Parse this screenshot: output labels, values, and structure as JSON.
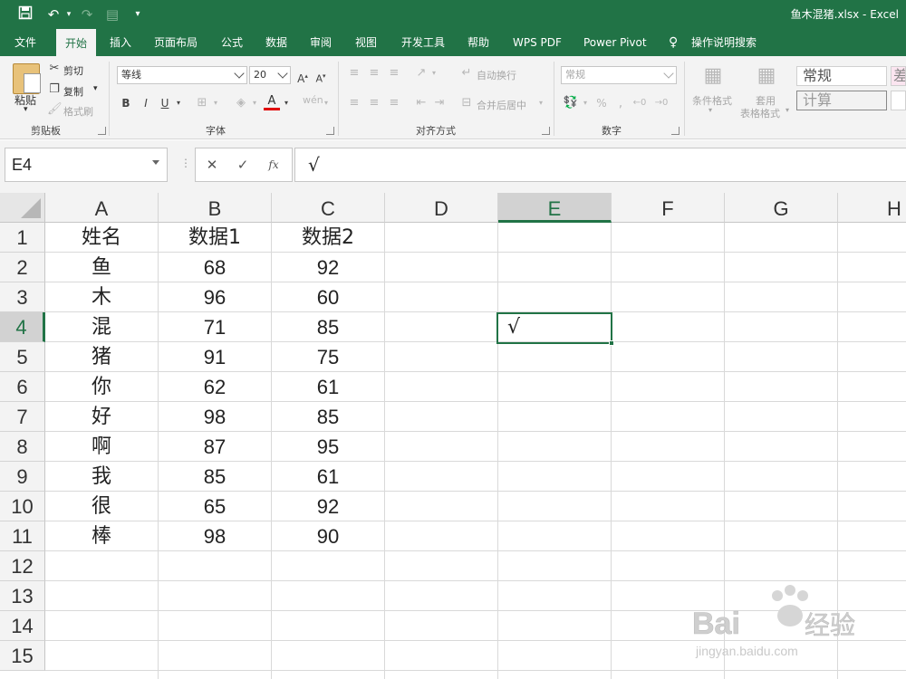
{
  "titlebar": {
    "title": "鱼木混猪.xlsx  -  Excel"
  },
  "tabs": [
    "文件",
    "开始",
    "插入",
    "页面布局",
    "公式",
    "数据",
    "审阅",
    "视图",
    "开发工具",
    "帮助",
    "WPS PDF",
    "Power Pivot"
  ],
  "active_tab": "开始",
  "help_search": "操作说明搜索",
  "ribbon": {
    "clipboard": {
      "paste": "粘贴",
      "cut": "剪切",
      "copy": "复制",
      "format_painter": "格式刷",
      "group": "剪贴板"
    },
    "font": {
      "name": "等线",
      "size": "20",
      "bold": "B",
      "italic": "I",
      "underline": "U",
      "group": "字体"
    },
    "alignment": {
      "wrap": "自动换行",
      "merge": "合并后居中",
      "group": "对齐方式"
    },
    "number": {
      "format": "常规",
      "percent": "%",
      "group": "数字"
    },
    "styles": {
      "conditional": "条件格式",
      "table_format_1": "套用",
      "table_format_2": "表格格式",
      "normal": "常规",
      "calc": "计算",
      "bad": "差"
    }
  },
  "formula_bar": {
    "name_box": "E4",
    "cancel": "✕",
    "enter": "✓",
    "fx": "fx",
    "content": "√"
  },
  "sheet": {
    "columns": [
      "A",
      "B",
      "C",
      "D",
      "E",
      "F",
      "G",
      "H"
    ],
    "rows": [
      "1",
      "2",
      "3",
      "4",
      "5",
      "6",
      "7",
      "8",
      "9",
      "10",
      "11",
      "12",
      "13",
      "14",
      "15"
    ],
    "selected_column": "E",
    "selected_row": "4",
    "header": [
      "姓名",
      "数据1",
      "数据2"
    ],
    "data": [
      [
        "鱼",
        "68",
        "92"
      ],
      [
        "木",
        "96",
        "60"
      ],
      [
        "混",
        "71",
        "85"
      ],
      [
        "猪",
        "91",
        "75"
      ],
      [
        "你",
        "62",
        "61"
      ],
      [
        "好",
        "98",
        "85"
      ],
      [
        "啊",
        "87",
        "95"
      ],
      [
        "我",
        "85",
        "61"
      ],
      [
        "很",
        "65",
        "92"
      ],
      [
        "棒",
        "98",
        "90"
      ]
    ],
    "active_cell_value": "√"
  },
  "watermark": {
    "brand": "Baidu经验",
    "url": "jingyan.baidu.com"
  }
}
